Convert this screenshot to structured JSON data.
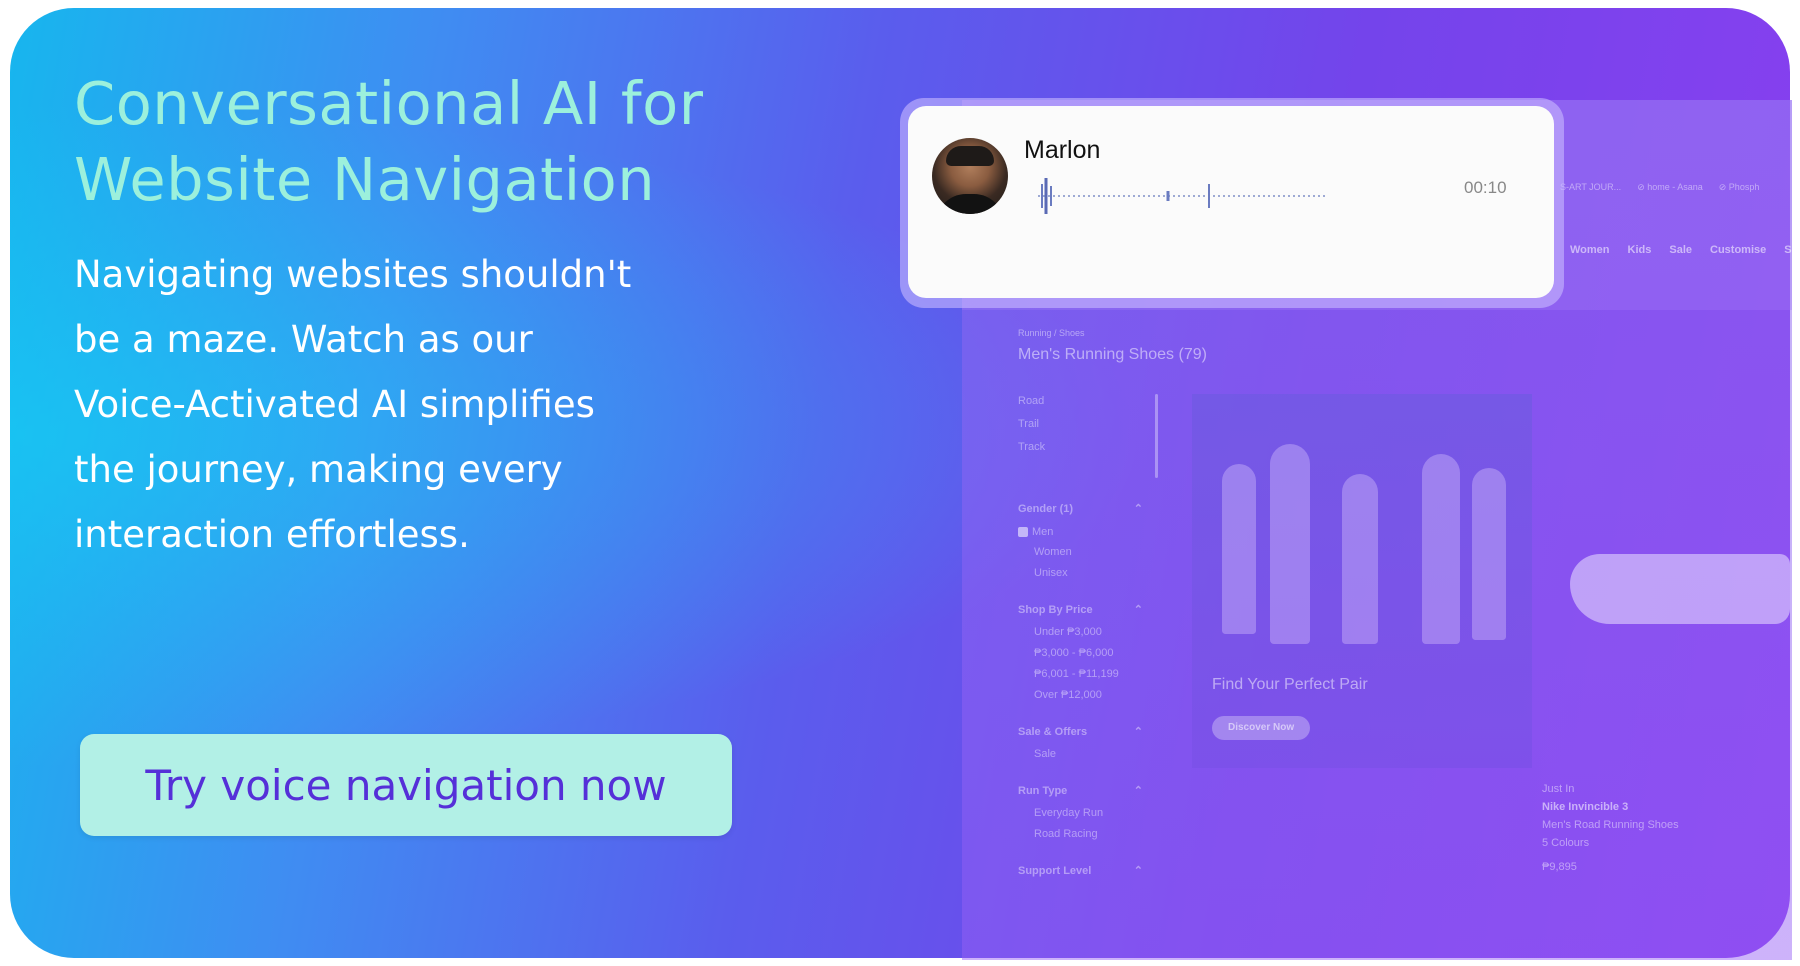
{
  "hero": {
    "title_line1": "Conversational AI for",
    "title_line2": "Website Navigation",
    "description_lines": [
      "Navigating websites shouldn't",
      "be a maze. Watch as our",
      "Voice-Activated AI simplifies",
      "the journey, making every",
      "interaction effortless."
    ],
    "cta_label": "Try voice navigation now"
  },
  "voice_card": {
    "speaker": "Marlon",
    "timer": "00:10"
  },
  "website": {
    "topbar_items": [
      "S-ART JOUR...",
      "⊘ home - Asana",
      "⊘ Phosph"
    ],
    "nav_items": [
      "Women",
      "Kids",
      "Sale",
      "Customise",
      "SN"
    ],
    "breadcrumb": "Running / Shoes",
    "heading": "Men's Running Shoes (79)",
    "categories": [
      "Road",
      "Trail",
      "Track"
    ],
    "filters": {
      "gender_label": "Gender (1)",
      "gender_options": [
        "Men",
        "Women",
        "Unisex"
      ],
      "price_label": "Shop By Price",
      "price_options": [
        "Under ₱3,000",
        "₱3,000 - ₱6,000",
        "₱6,001 - ₱11,199",
        "Over ₱12,000"
      ],
      "sale_label": "Sale & Offers",
      "sale_options": [
        "Sale"
      ],
      "run_type_label": "Run Type",
      "run_type_options": [
        "Everyday Run",
        "Road Racing"
      ],
      "support_label": "Support Level"
    },
    "promo": {
      "text": "Find Your Perfect Pair",
      "button": "Discover Now"
    },
    "product": {
      "badge": "Just In",
      "name": "Nike Invincible 3",
      "category": "Men's Road Running Shoes",
      "colours": "5 Colours",
      "price": "₱9,895"
    }
  },
  "colors": {
    "gradient_start": "#17b6ee",
    "gradient_end": "#8a3ff0",
    "headline": "#9cf0dc",
    "cta_background": "#b2f0e6",
    "cta_text": "#5530d8"
  }
}
